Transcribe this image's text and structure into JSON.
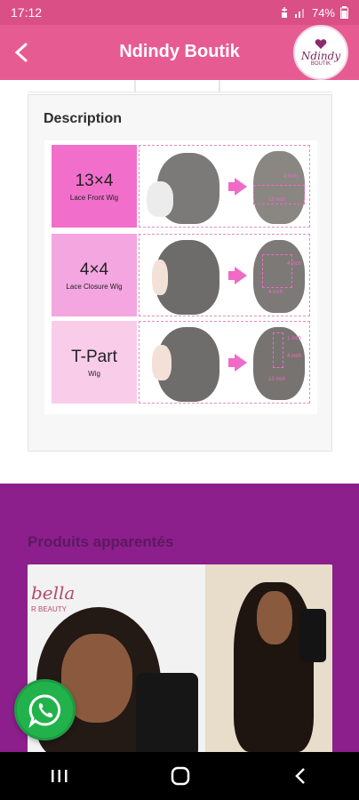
{
  "status_bar": {
    "time": "17:12",
    "battery": "74%"
  },
  "app_bar": {
    "title": "Ndindy Boutik",
    "logo_text": "Ndindy",
    "logo_sub": "BOUTIK"
  },
  "description": {
    "title": "Description",
    "rows": [
      {
        "main": "13×4",
        "sub": "Lace Front Wig"
      },
      {
        "main": "4×4",
        "sub": "Lace Closure Wig"
      },
      {
        "main": "T-Part",
        "sub": "Wig"
      }
    ],
    "measure_labels": [
      "4 inch",
      "13 inch",
      "4 inch",
      "4 inch",
      "1 inch",
      "4 inch",
      "13 inch"
    ]
  },
  "related": {
    "title": "Produits apparentés",
    "brand_text": "bella",
    "brand_sub": "R BEAUTY"
  },
  "colors": {
    "primary": "#e75b93",
    "status": "#d94f86",
    "related_bg": "#8c1f8c",
    "whatsapp": "#22b24c"
  }
}
